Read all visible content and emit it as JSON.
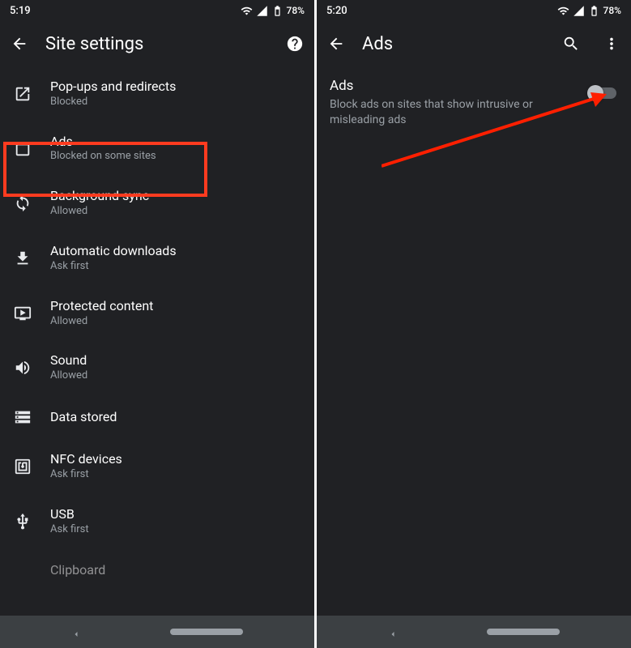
{
  "left": {
    "status": {
      "time": "5:19",
      "battery": "78%"
    },
    "title": "Site settings",
    "items": [
      {
        "label": "Pop-ups and redirects",
        "sub": "Blocked",
        "icon": "popup"
      },
      {
        "label": "Ads",
        "sub": "Blocked on some sites",
        "icon": "ads"
      },
      {
        "label": "Background sync",
        "sub": "Allowed",
        "icon": "sync"
      },
      {
        "label": "Automatic downloads",
        "sub": "Ask first",
        "icon": "download"
      },
      {
        "label": "Protected content",
        "sub": "Allowed",
        "icon": "protected"
      },
      {
        "label": "Sound",
        "sub": "Allowed",
        "icon": "sound"
      },
      {
        "label": "Data stored",
        "sub": "",
        "icon": "storage"
      },
      {
        "label": "NFC devices",
        "sub": "Ask first",
        "icon": "nfc"
      },
      {
        "label": "USB",
        "sub": "Ask first",
        "icon": "usb"
      },
      {
        "label": "Clipboard",
        "sub": "",
        "icon": "clipboard"
      }
    ]
  },
  "right": {
    "status": {
      "time": "5:20",
      "battery": "78%"
    },
    "title": "Ads",
    "heading": "Ads",
    "description": "Block ads on sites that show intrusive or misleading ads",
    "toggle_on": false
  }
}
